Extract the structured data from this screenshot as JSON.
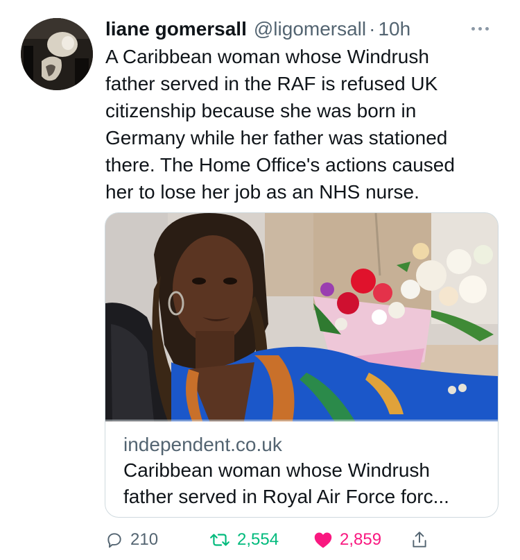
{
  "tweet": {
    "display_name": "liane gomersall",
    "handle": "@ligomersall",
    "separator": "·",
    "time": "10h",
    "text": "A Caribbean woman whose Windrush\nfather served in the RAF is refused UK\ncitizenship because she was born in\nGermany while her father was stationed\nthere. The Home Office's actions caused\nher to lose her job as an NHS nurse."
  },
  "card": {
    "domain": "independent.co.uk",
    "title": "Caribbean woman whose Windrush\nfather served in Royal Air Force forc..."
  },
  "actions": {
    "replies": "210",
    "retweets": "2,554",
    "likes": "2,859"
  },
  "icons": {
    "reply": "reply-icon",
    "retweet": "retweet-icon",
    "like": "heart-icon",
    "share": "share-icon",
    "more": "more-icon"
  },
  "colors": {
    "retweet": "#00ba7c",
    "like": "#f91880",
    "secondary_text": "#536471"
  }
}
